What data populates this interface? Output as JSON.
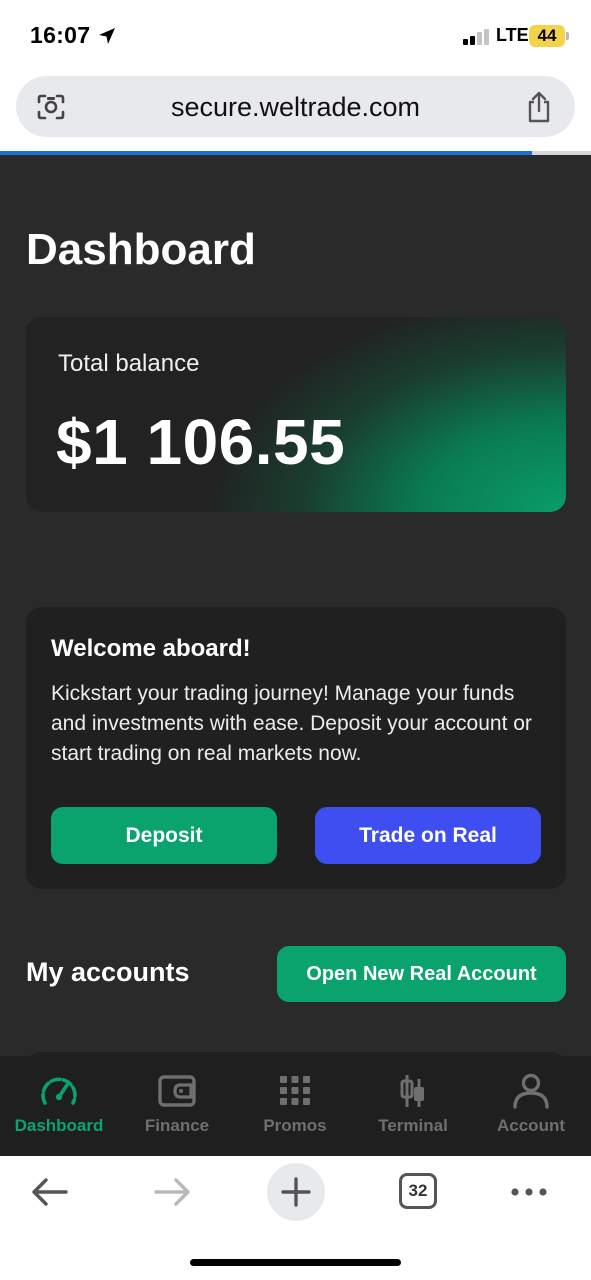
{
  "status_bar": {
    "time": "16:07",
    "network": "LTE",
    "battery": "44"
  },
  "browser": {
    "url": "secure.weltrade.com",
    "load_progress_percent": 90,
    "tab_count": "32"
  },
  "page": {
    "title": "Dashboard"
  },
  "balance": {
    "label": "Total balance",
    "value": "$1 106.55"
  },
  "welcome": {
    "title": "Welcome aboard!",
    "body": "Kickstart your trading journey! Manage your funds and investments with ease. Deposit your account or start trading on real markets now.",
    "deposit_label": "Deposit",
    "trade_label": "Trade on Real"
  },
  "accounts": {
    "title": "My accounts",
    "open_label": "Open New Real Account"
  },
  "nav": {
    "items": [
      {
        "label": "Dashboard",
        "icon": "speedometer-icon",
        "active": true
      },
      {
        "label": "Finance",
        "icon": "wallet-icon",
        "active": false
      },
      {
        "label": "Promos",
        "icon": "grid-icon",
        "active": false
      },
      {
        "label": "Terminal",
        "icon": "candlestick-icon",
        "active": false
      },
      {
        "label": "Account",
        "icon": "user-icon",
        "active": false
      }
    ]
  },
  "colors": {
    "accent_green": "#0aa36d",
    "accent_blue": "#3e4ef0",
    "background": "#2a2a2a",
    "card": "#202020"
  }
}
